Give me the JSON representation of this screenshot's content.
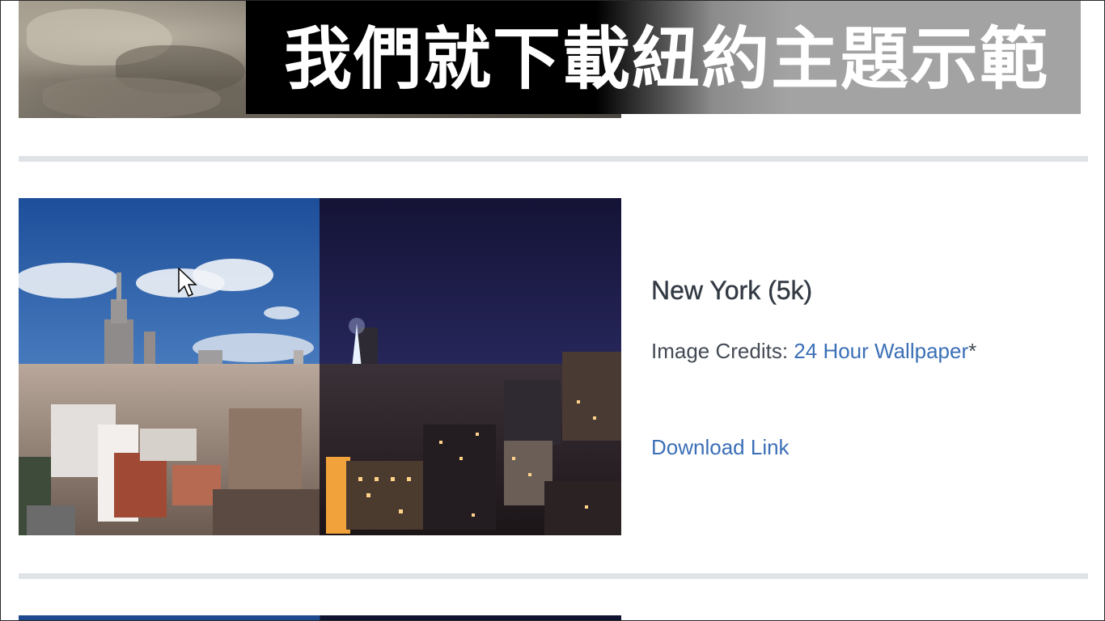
{
  "caption": {
    "text": "我們就下載紐約主題示範"
  },
  "wallpaper": {
    "title": "New York (5k)",
    "credits_label": "Image Credits: ",
    "credits_link": "24 Hour Wallpaper",
    "credits_suffix": "*",
    "download_label": "Download Link"
  },
  "colors": {
    "link": "#3b6fb6",
    "divider": "#dfe2e6",
    "title": "#333a44"
  }
}
